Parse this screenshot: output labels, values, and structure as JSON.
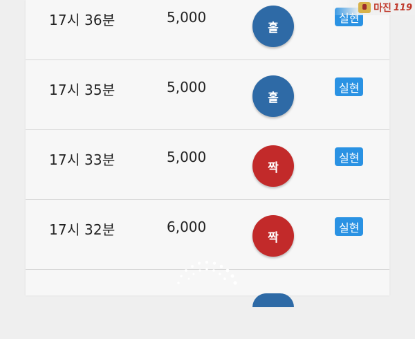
{
  "logo": {
    "text": "마진",
    "suffix": "119",
    "tagline": ""
  },
  "rows": [
    {
      "time": "17시 36분",
      "amount": "5,000",
      "result": "홀",
      "status": "실현"
    },
    {
      "time": "17시 35분",
      "amount": "5,000",
      "result": "홀",
      "status": "실현"
    },
    {
      "time": "17시 33분",
      "amount": "5,000",
      "result": "짝",
      "status": "실현"
    },
    {
      "time": "17시 32분",
      "amount": "6,000",
      "result": "짝",
      "status": "실현"
    }
  ],
  "colors": {
    "odd": "#2e6aa6",
    "even": "#c22a2a",
    "badge": "#2a92e3"
  },
  "icons": {
    "loading": "loading-spinner-icon"
  }
}
